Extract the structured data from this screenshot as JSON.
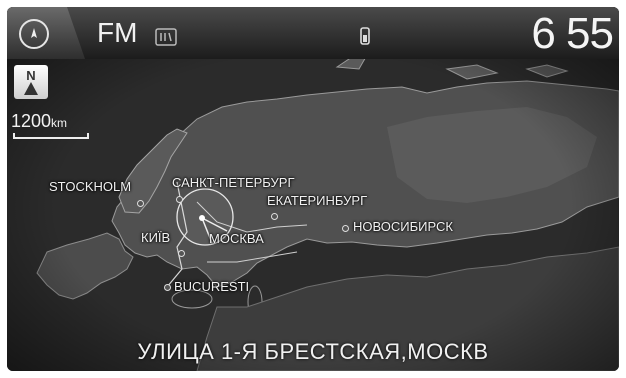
{
  "status_bar": {
    "source": "FM",
    "clock": "6 55",
    "icons": [
      "compass-icon",
      "rds-icon",
      "phone-battery-icon"
    ]
  },
  "map": {
    "north_label": "N",
    "scale_value": "1200",
    "scale_unit": "km",
    "cities": {
      "stockholm": "STOCKHOLM",
      "spb": "САНКТ-ПЕТЕРБУРГ",
      "yekaterinburg": "ЕКАТЕРИНБУРГ",
      "novosibirsk": "НОВОСИБИРСК",
      "kyiv": "КИЇВ",
      "moscow": "МОСКВА",
      "bucuresti": "BUCURESTI"
    }
  },
  "street": "УЛИЦА 1-Я БРЕСТСКАЯ,МОСКВ"
}
